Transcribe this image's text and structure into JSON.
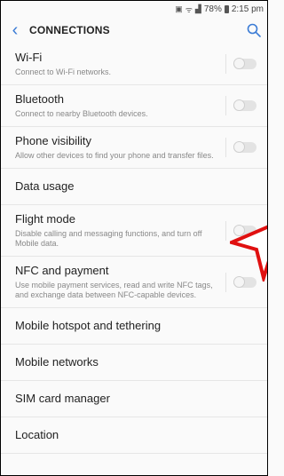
{
  "status_bar": {
    "battery_text": "78%",
    "time": "2:15 pm"
  },
  "header": {
    "title": "CONNECTIONS"
  },
  "items": [
    {
      "title": "Wi-Fi",
      "subtitle": "Connect to Wi-Fi networks.",
      "toggle": "off"
    },
    {
      "title": "Bluetooth",
      "subtitle": "Connect to nearby Bluetooth devices.",
      "toggle": "off"
    },
    {
      "title": "Phone visibility",
      "subtitle": "Allow other devices to find your phone and transfer files.",
      "toggle": "off"
    },
    {
      "title": "Data usage"
    },
    {
      "title": "Flight mode",
      "subtitle": "Disable calling and messaging functions, and turn off Mobile data.",
      "toggle": "off"
    },
    {
      "title": "NFC and payment",
      "subtitle": "Use mobile payment services, read and write NFC tags, and exchange data between NFC-capable devices.",
      "toggle": "off"
    },
    {
      "title": "Mobile hotspot and tethering"
    },
    {
      "title": "Mobile networks"
    },
    {
      "title": "SIM card manager"
    },
    {
      "title": "Location"
    }
  ],
  "colors": {
    "accent": "#3a7bd5",
    "annotation": "#e01010"
  }
}
